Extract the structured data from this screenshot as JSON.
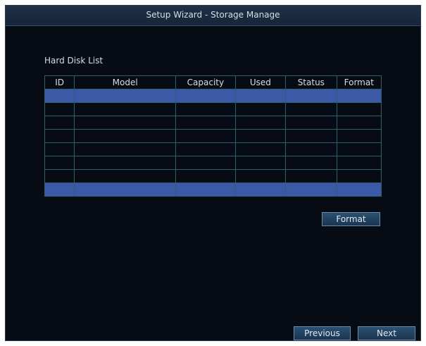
{
  "window": {
    "title": "Setup Wizard - Storage Manage"
  },
  "disk_list": {
    "label": "Hard Disk List",
    "columns": [
      "ID",
      "Model",
      "Capacity",
      "Used",
      "Status",
      "Format"
    ],
    "rows": [
      {
        "id": "",
        "model": "",
        "capacity": "",
        "used": "",
        "status": "",
        "format": "",
        "selected": true
      },
      {
        "id": "",
        "model": "",
        "capacity": "",
        "used": "",
        "status": "",
        "format": "",
        "selected": false
      },
      {
        "id": "",
        "model": "",
        "capacity": "",
        "used": "",
        "status": "",
        "format": "",
        "selected": false
      },
      {
        "id": "",
        "model": "",
        "capacity": "",
        "used": "",
        "status": "",
        "format": "",
        "selected": false
      },
      {
        "id": "",
        "model": "",
        "capacity": "",
        "used": "",
        "status": "",
        "format": "",
        "selected": false
      },
      {
        "id": "",
        "model": "",
        "capacity": "",
        "used": "",
        "status": "",
        "format": "",
        "selected": false
      },
      {
        "id": "",
        "model": "",
        "capacity": "",
        "used": "",
        "status": "",
        "format": "",
        "selected": false
      },
      {
        "id": "",
        "model": "",
        "capacity": "",
        "used": "",
        "status": "",
        "format": "",
        "selected": true
      }
    ]
  },
  "actions": {
    "format_label": "Format"
  },
  "navigation": {
    "previous_label": "Previous",
    "next_label": "Next"
  },
  "colors": {
    "background": "#070b14",
    "selected_row": "#3b59a6",
    "grid_line": "#2b6070"
  }
}
